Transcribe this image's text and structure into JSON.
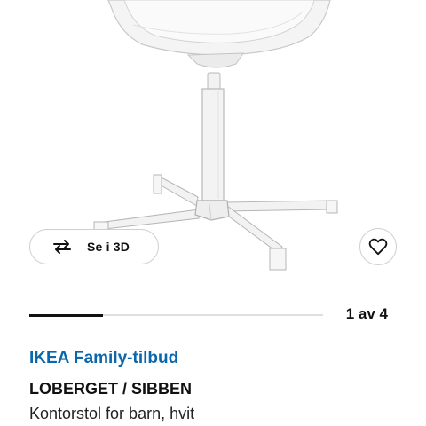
{
  "product_image": {
    "alt": "LOBERGET / SIBBEN"
  },
  "actions": {
    "view_3d_label": "Se i 3D",
    "view_3d_icon": "rotate-arrows-icon",
    "favorite_icon": "heart-icon"
  },
  "gallery": {
    "counter": "1 av 4",
    "current": 1,
    "total": 4
  },
  "product": {
    "offer": "IKEA Family-tilbud",
    "name": "LOBERGET / SIBBEN",
    "description": "Kontorstol for barn, hvit"
  },
  "colors": {
    "offer_blue": "#0a66ad",
    "text": "#111111",
    "border": "#cfcfcf"
  }
}
